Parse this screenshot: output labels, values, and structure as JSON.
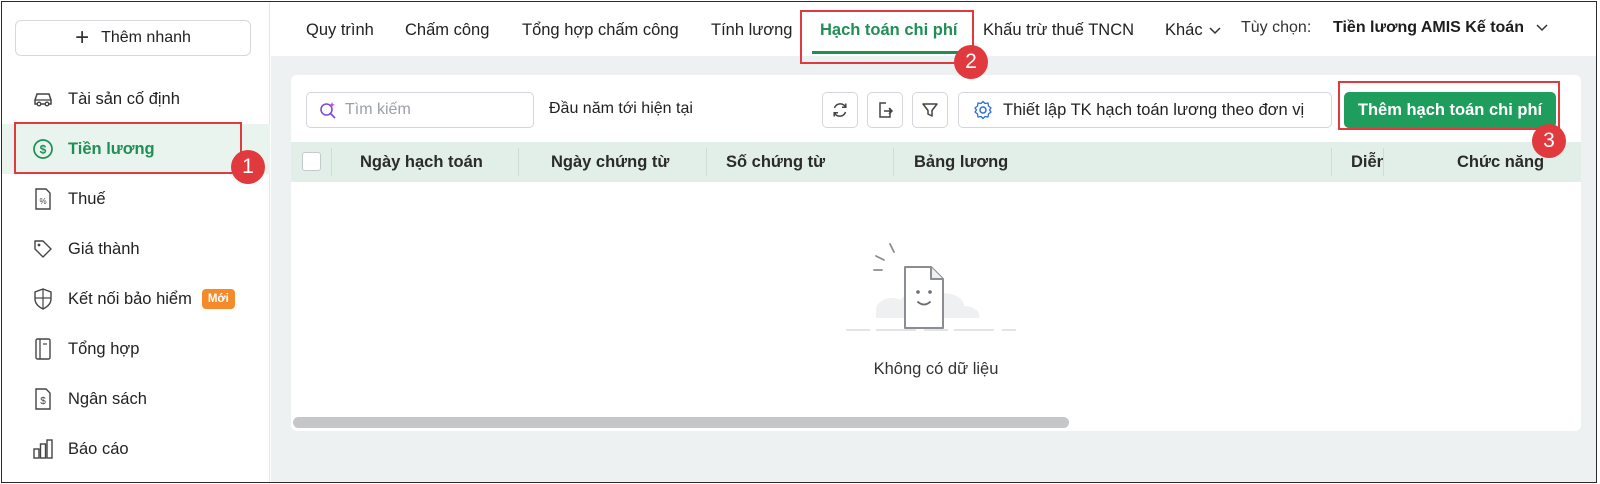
{
  "sidebar": {
    "quick_add": "Thêm nhanh",
    "items": [
      {
        "label": "Tài sản cố định",
        "icon": "car-icon"
      },
      {
        "label": "Tiền lương",
        "icon": "dollar-circle-icon",
        "active": true
      },
      {
        "label": "Thuế",
        "icon": "tax-document-icon"
      },
      {
        "label": "Giá thành",
        "icon": "tag-icon"
      },
      {
        "label": "Kết nối bảo hiểm",
        "icon": "shield-icon",
        "badge": "Mới"
      },
      {
        "label": "Tổng hợp",
        "icon": "ledger-book-icon"
      },
      {
        "label": "Ngân sách",
        "icon": "budget-document-icon"
      },
      {
        "label": "Báo cáo",
        "icon": "bar-chart-icon"
      }
    ]
  },
  "topbar": {
    "tabs": [
      "Quy trình",
      "Chấm công",
      "Tổng hợp chấm công",
      "Tính lương",
      "Hạch toán chi phí",
      "Khấu trừ thuế TNCN",
      "Khác"
    ],
    "active_tab": "Hạch toán chi phí",
    "option_label": "Tùy chọn:",
    "option_value": "Tiền lương AMIS Kế toán"
  },
  "toolbar": {
    "search_placeholder": "Tìm kiếm",
    "period": "Đầu năm tới hiện tại",
    "setup_label": "Thiết lập TK hạch toán lương theo đơn vị",
    "add_label": "Thêm hạch toán chi phí"
  },
  "table": {
    "columns": [
      "Ngày hạch toán",
      "Ngày chứng từ",
      "Số chứng từ",
      "Bảng lương",
      "Diễn",
      "Chức năng"
    ],
    "rows": [],
    "empty_text": "Không có dữ liệu"
  },
  "callouts": [
    "1",
    "2",
    "3"
  ],
  "colors": {
    "accent": "#1f9d5c",
    "accent_text": "#1f8f55",
    "highlight": "#e0393e",
    "badge": "#f48a2a",
    "header_bg": "#e2efe8"
  }
}
